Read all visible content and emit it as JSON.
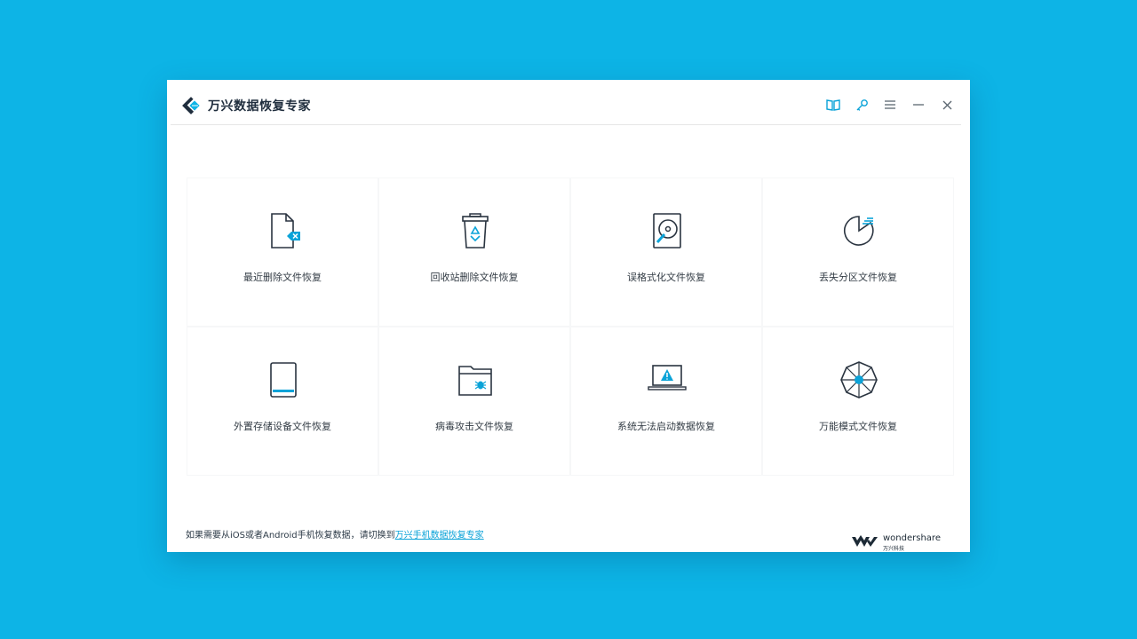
{
  "app": {
    "title": "万兴数据恢复专家"
  },
  "titlebar": {
    "buttons": [
      "guide-icon",
      "key-icon",
      "menu-icon",
      "minimize-icon",
      "close-icon"
    ]
  },
  "colors": {
    "background": "#0db4e6",
    "accent": "#0ba3d8",
    "icon_stroke": "#2a3440"
  },
  "modes": [
    {
      "label": "最近删除文件恢复",
      "icon": "deleted-file-icon"
    },
    {
      "label": "回收站删除文件恢复",
      "icon": "recycle-bin-icon"
    },
    {
      "label": "误格式化文件恢复",
      "icon": "formatted-disk-icon"
    },
    {
      "label": "丢失分区文件恢复",
      "icon": "lost-partition-icon"
    },
    {
      "label": "外置存储设备文件恢复",
      "icon": "external-device-icon"
    },
    {
      "label": "病毒攻击文件恢复",
      "icon": "virus-folder-icon"
    },
    {
      "label": "系统无法启动数据恢复",
      "icon": "system-crash-icon"
    },
    {
      "label": "万能模式文件恢复",
      "icon": "all-around-icon"
    }
  ],
  "footer": {
    "note": "如果需要从iOS或者Android手机恢复数据，请切换到",
    "link": "万兴手机数据恢复专家"
  },
  "brand": {
    "name": "wondershare",
    "sub": "万兴科技"
  }
}
